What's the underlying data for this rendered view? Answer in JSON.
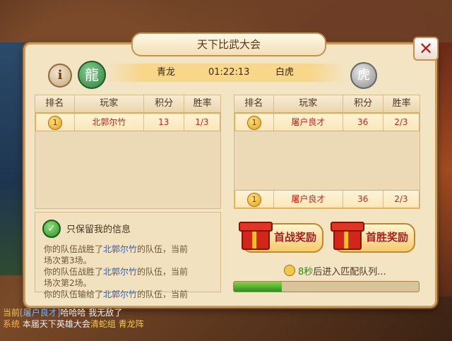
{
  "title": "天下比武大会",
  "close_label": "✕",
  "info_label": "i",
  "teams": {
    "left": "青龙",
    "timer": "01:22:13",
    "right": "白虎"
  },
  "table_headers": [
    "排名",
    "玩家",
    "积分",
    "胜率"
  ],
  "left_table": [
    {
      "rank": "1",
      "player": "北郭尔竹",
      "score": "13",
      "rate": "1/3"
    }
  ],
  "right_table": [
    {
      "rank": "1",
      "player": "屠户良才",
      "score": "36",
      "rate": "2/3"
    }
  ],
  "right_self": {
    "rank": "1",
    "player": "屠户良才",
    "score": "36",
    "rate": "2/3"
  },
  "message_panel": {
    "toggle_label": "只保留我的信息",
    "lines": [
      {
        "a": "你的队伍战胜了",
        "b": "北郭尔竹",
        "c": "的队伍，当前"
      },
      {
        "a": "场次第3场。",
        "b": "",
        "c": ""
      },
      {
        "a": "你的队伍战胜了",
        "b": "北郭尔竹",
        "c": "的队伍，当前"
      },
      {
        "a": "场次第2场。",
        "b": "",
        "c": ""
      },
      {
        "a": "你的队伍输给了",
        "b": "北郭尔竹",
        "c": "的队伍，当前"
      }
    ]
  },
  "rewards": {
    "first_battle": "首战奖励",
    "first_win": "首胜奖励"
  },
  "countdown": {
    "seconds": "8秒",
    "text": "后进入匹配队列..."
  },
  "progress_fraction": 0.26,
  "chat": [
    {
      "a": "当前",
      "b": "[屠户良才]",
      "c": "哈哈哈   我无敌了"
    },
    {
      "a": "系统",
      "b": "本届天下英雄大会",
      "c": "清蛇组 青龙阵"
    }
  ]
}
